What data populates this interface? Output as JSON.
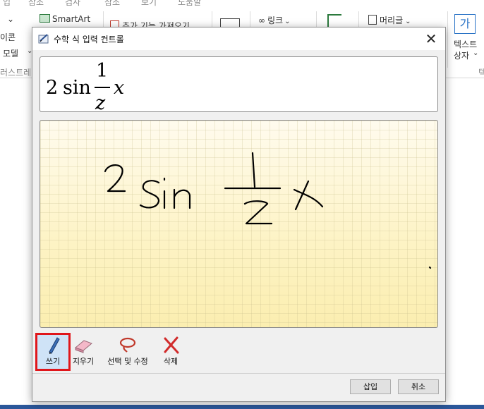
{
  "ribbon": {
    "smartart_label": "SmartArt",
    "addins_label": "추가 기능 가져오기",
    "link_label": "링크",
    "header_label": "머리글",
    "textbox_line1": "텍스트",
    "textbox_line2": "상자",
    "textbox_glyph": "가",
    "left_items": [
      "이콘",
      "모델",
      "러스트레"
    ],
    "top_fragments": [
      "입",
      "참조",
      "검사",
      "참조",
      "보기",
      "도움말"
    ],
    "right_edge": "텍"
  },
  "dialog": {
    "title": "수학 식 입력 컨트롤",
    "close_glyph": "✕",
    "preview": {
      "coefficient": "2",
      "function": "sin",
      "numerator": "1",
      "denominator": "z",
      "variable": "x"
    },
    "tools": [
      {
        "label": "쓰기",
        "icon": "pen-icon",
        "selected": true
      },
      {
        "label": "지우기",
        "icon": "eraser-icon",
        "selected": false
      },
      {
        "label": "선택 및 수정",
        "icon": "lasso-icon",
        "selected": false
      },
      {
        "label": "삭제",
        "icon": "delete-x-icon",
        "selected": false
      }
    ],
    "insert_label": "삽입",
    "cancel_label": "취소"
  },
  "colors": {
    "accent_selected_border": "#e0161b",
    "ink": "#000000",
    "ink_area_background": "#fdf6cf",
    "taskbar": "#2b579a"
  }
}
